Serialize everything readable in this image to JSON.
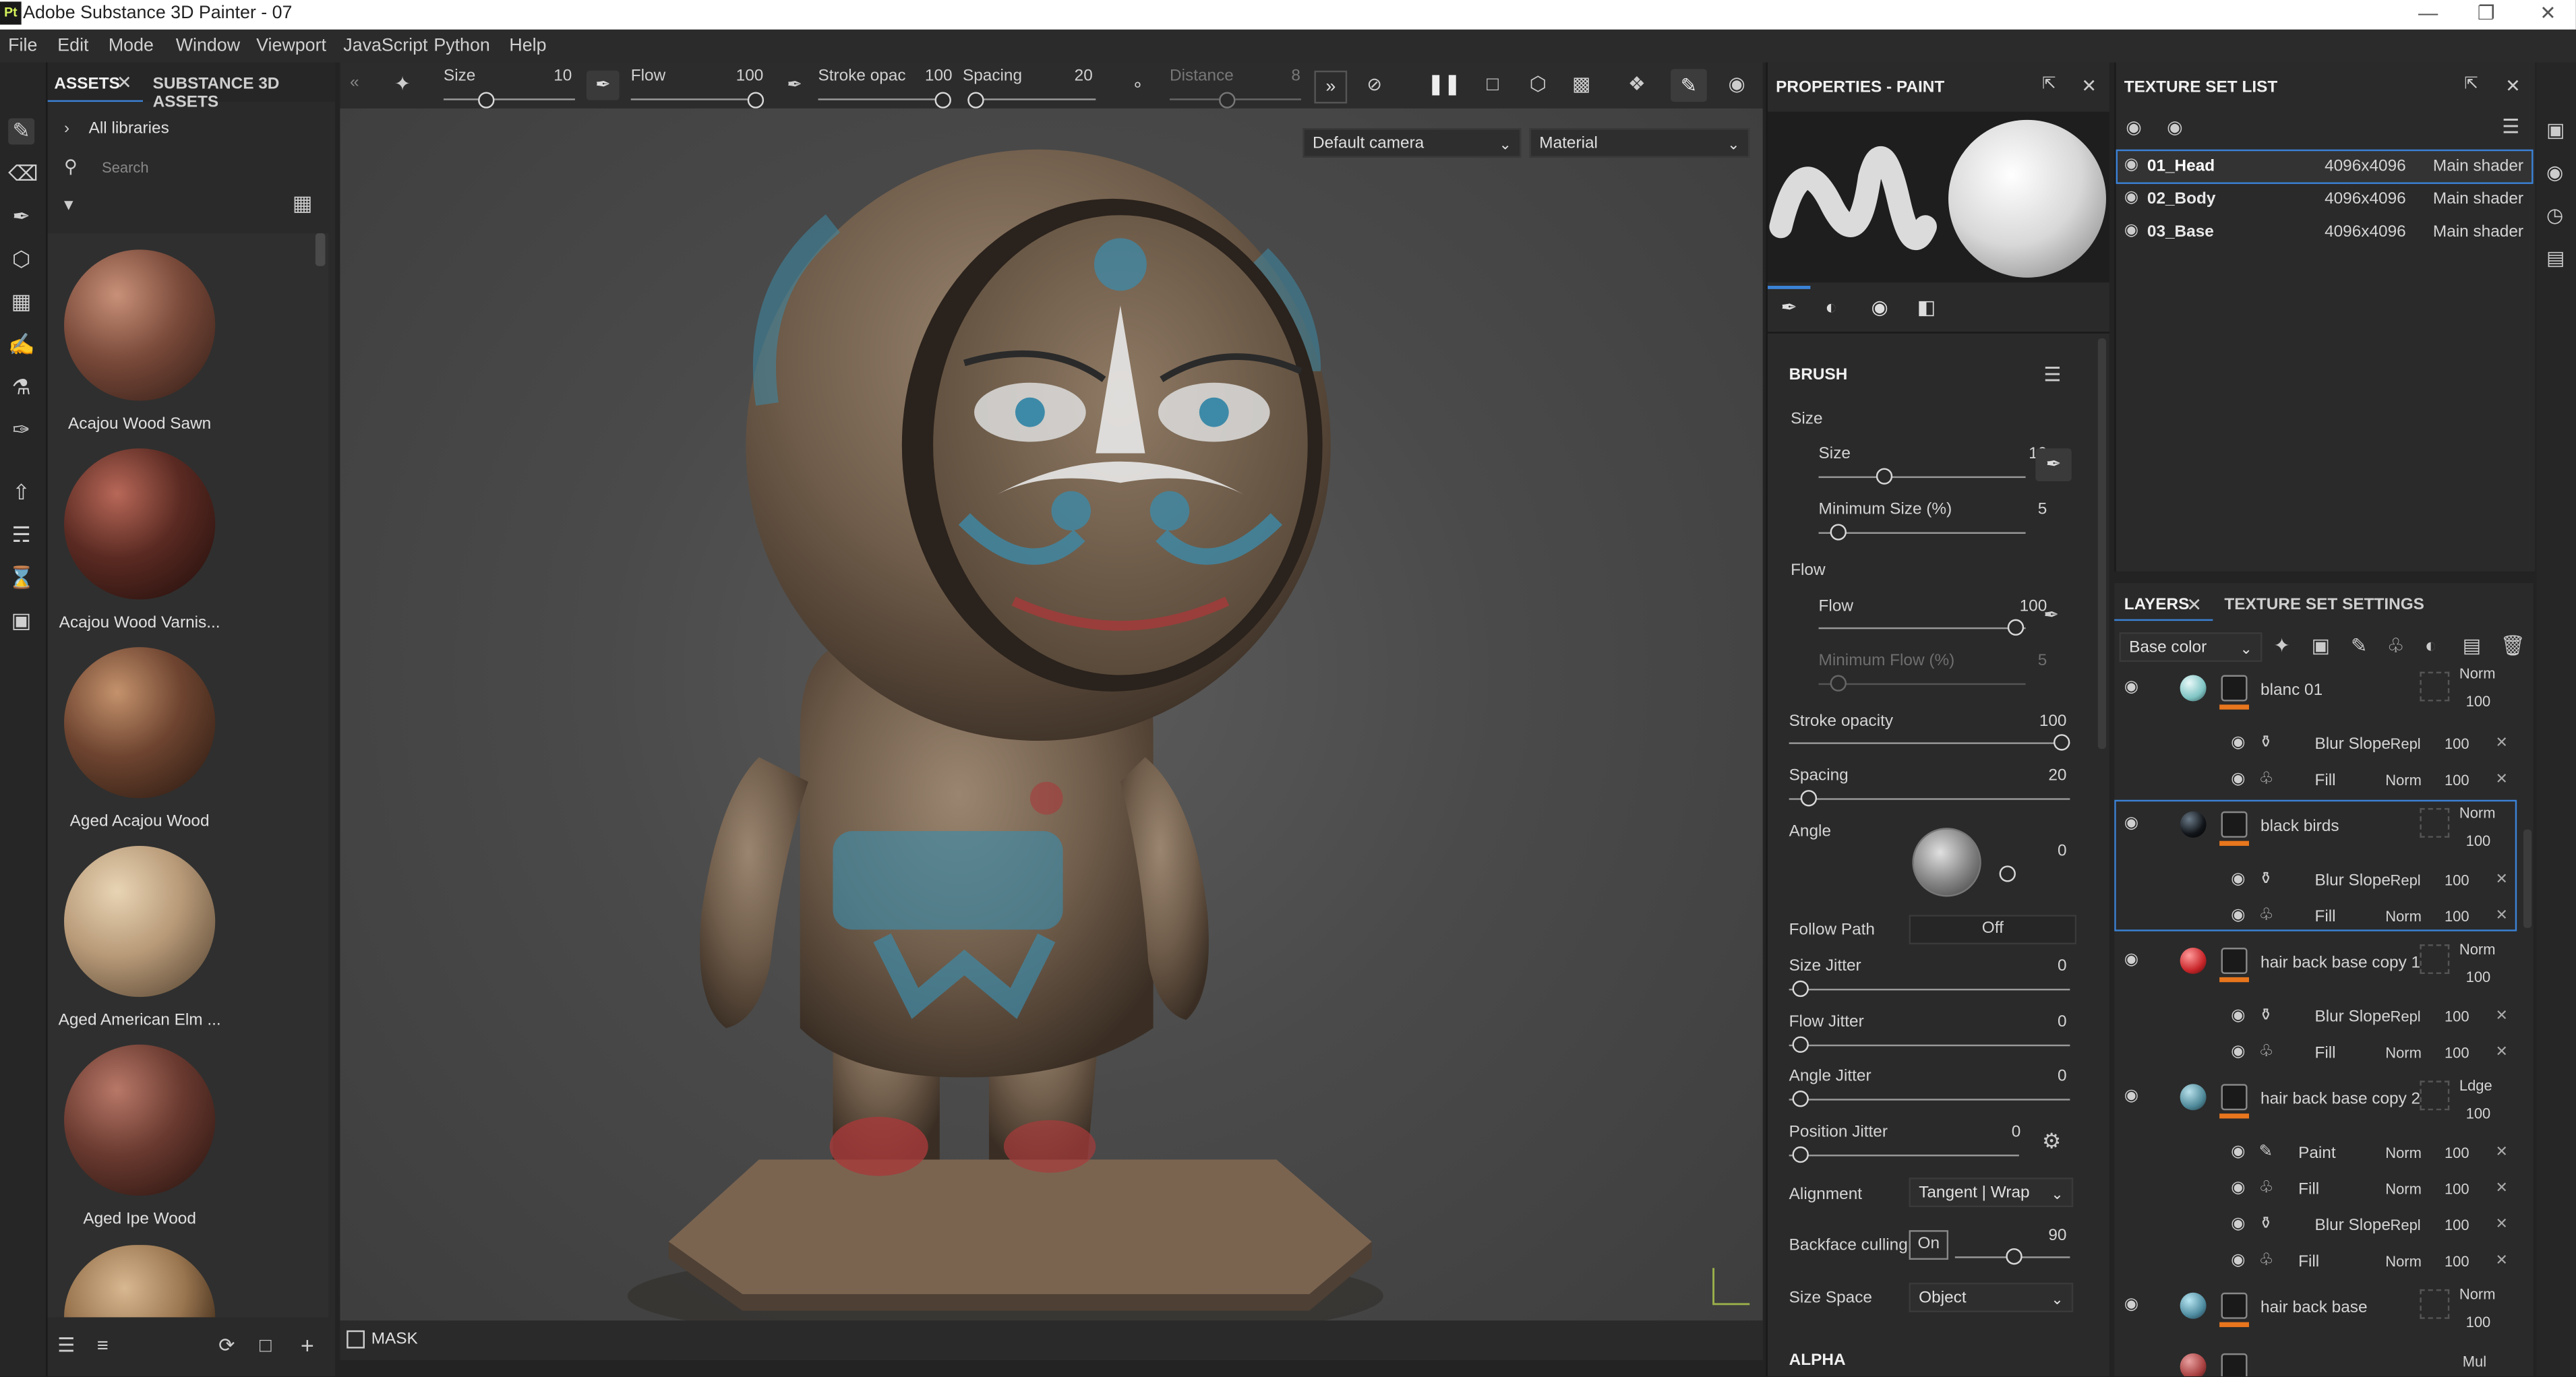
{
  "window": {
    "title": "Adobe Substance 3D Painter - 07",
    "logo": "Pt"
  },
  "menu": [
    "File",
    "Edit",
    "Mode",
    "Window",
    "Viewport",
    "JavaScript",
    "Python",
    "Help"
  ],
  "assets": {
    "tab_assets": "ASSETS",
    "tab_substance": "SUBSTANCE 3D ASSETS",
    "breadcrumb": "All libraries",
    "search_placeholder": "Search",
    "items": [
      {
        "label": "Acajou Wood Sawn",
        "color": "#7a4a3a"
      },
      {
        "label": "Acajou Wood Varnis...",
        "color": "#5a2a22"
      },
      {
        "label": "Aged Acajou Wood",
        "color": "#6e4430"
      },
      {
        "label": "Aged American Elm ...",
        "color": "#b89a78"
      },
      {
        "label": "Aged Ipe Wood",
        "color": "#6a3a30"
      }
    ]
  },
  "toolbar": {
    "size_label": "Size",
    "size_value": "10",
    "flow_label": "Flow",
    "flow_value": "100",
    "stroke_label": "Stroke opac",
    "stroke_value": "100",
    "spacing_label": "Spacing",
    "spacing_value": "20",
    "distance_label": "Distance",
    "distance_value": "8"
  },
  "viewport": {
    "camera": "Default camera",
    "mode": "Material",
    "mask_label": "MASK"
  },
  "properties": {
    "title": "PROPERTIES - PAINT",
    "brush_title": "BRUSH",
    "size_group": "Size",
    "size_label": "Size",
    "size_value": "10",
    "min_size_label": "Minimum Size (%)",
    "min_size_value": "5",
    "flow_group": "Flow",
    "flow_label": "Flow",
    "flow_value": "100",
    "min_flow_label": "Minimum Flow (%)",
    "min_flow_value": "5",
    "stroke_label": "Stroke opacity",
    "stroke_value": "100",
    "spacing_label": "Spacing",
    "spacing_value": "20",
    "angle_label": "Angle",
    "angle_value": "0",
    "follow_path_label": "Follow Path",
    "follow_path_value": "Off",
    "size_jitter_label": "Size Jitter",
    "size_jitter_value": "0",
    "flow_jitter_label": "Flow Jitter",
    "flow_jitter_value": "0",
    "angle_jitter_label": "Angle Jitter",
    "angle_jitter_value": "0",
    "position_jitter_label": "Position Jitter",
    "position_jitter_value": "0",
    "alignment_label": "Alignment",
    "alignment_value": "Tangent | Wrap",
    "backface_label": "Backface culling",
    "backface_toggle": "On",
    "backface_value": "90",
    "size_space_label": "Size Space",
    "size_space_value": "Object",
    "alpha_title": "ALPHA"
  },
  "texture_sets": {
    "title": "TEXTURE SET LIST",
    "items": [
      {
        "name": "01_Head",
        "res": "4096x4096",
        "shader": "Main shader"
      },
      {
        "name": "02_Body",
        "res": "4096x4096",
        "shader": "Main shader"
      },
      {
        "name": "03_Base",
        "res": "4096x4096",
        "shader": "Main shader"
      }
    ]
  },
  "layers": {
    "tab_layers": "LAYERS",
    "tab_tss": "TEXTURE SET SETTINGS",
    "channel": "Base color",
    "groups": [
      {
        "name": "blanc 01",
        "blend": "Norm",
        "opacity": "100",
        "color": "#7fc4c4",
        "effects": [
          {
            "name": "Blur Slope",
            "blend": "Repl",
            "opacity": "100",
            "icon": "filter-icon"
          },
          {
            "name": "Fill",
            "blend": "Norm",
            "opacity": "100",
            "icon": "fill-icon"
          }
        ]
      },
      {
        "name": "black birds",
        "blend": "Norm",
        "opacity": "100",
        "color": "#111418",
        "effects": [
          {
            "name": "Blur Slope",
            "blend": "Repl",
            "opacity": "100",
            "icon": "filter-icon"
          },
          {
            "name": "Fill",
            "blend": "Norm",
            "opacity": "100",
            "icon": "fill-icon"
          }
        ]
      },
      {
        "name": "hair back base copy 1",
        "blend": "Norm",
        "opacity": "100",
        "color": "#c8262a",
        "effects": [
          {
            "name": "Blur Slope",
            "blend": "Repl",
            "opacity": "100",
            "icon": "filter-icon"
          },
          {
            "name": "Fill",
            "blend": "Norm",
            "opacity": "100",
            "icon": "fill-icon"
          }
        ]
      },
      {
        "name": "hair back base copy 2",
        "blend": "Ldge",
        "opacity": "100",
        "color": "#4f8a9a",
        "effects": [
          {
            "name": "Paint",
            "blend": "Norm",
            "opacity": "100",
            "icon": "brush-icon"
          },
          {
            "name": "Fill",
            "blend": "Norm",
            "opacity": "100",
            "icon": "fill-icon"
          },
          {
            "name": "Blur Slope",
            "blend": "Repl",
            "opacity": "100",
            "icon": "filter-icon"
          },
          {
            "name": "Fill",
            "blend": "Norm",
            "opacity": "100",
            "icon": "fill-icon"
          }
        ]
      },
      {
        "name": "hair back base",
        "blend": "Norm",
        "opacity": "100",
        "color": "#4f8ca0",
        "effects": []
      }
    ],
    "last_blend": "Mul"
  }
}
